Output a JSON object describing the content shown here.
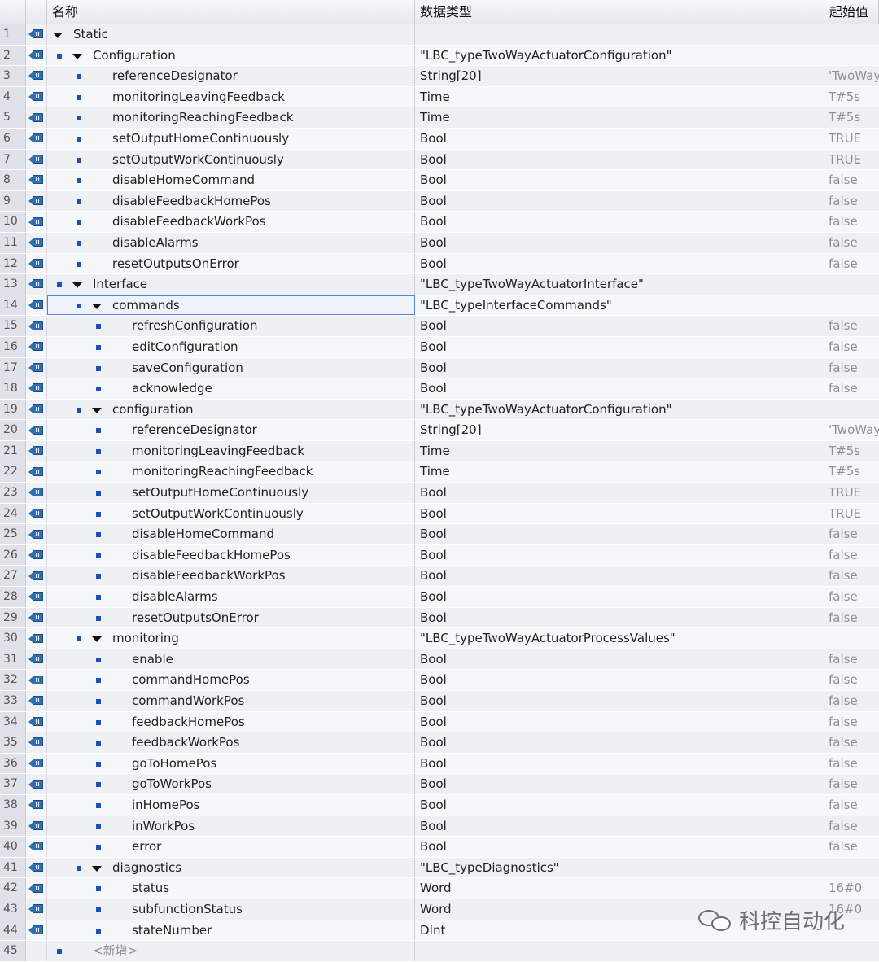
{
  "columns": {
    "name": "名称",
    "type": "数据类型",
    "start": "起始值"
  },
  "rows": [
    {
      "n": "1",
      "level": 0,
      "marker": false,
      "expand": true,
      "name": "Static",
      "type": "",
      "start": ""
    },
    {
      "n": "2",
      "level": 1,
      "marker": true,
      "expand": true,
      "name": "Configuration",
      "type": "\"LBC_typeTwoWayActuatorConfiguration\"",
      "start": ""
    },
    {
      "n": "3",
      "level": 2,
      "marker": true,
      "expand": false,
      "name": "referenceDesignator",
      "type": "String[20]",
      "start": "'TwoWay"
    },
    {
      "n": "4",
      "level": 2,
      "marker": true,
      "expand": false,
      "name": "monitoringLeavingFeedback",
      "type": "Time",
      "start": "T#5s"
    },
    {
      "n": "5",
      "level": 2,
      "marker": true,
      "expand": false,
      "name": "monitoringReachingFeedback",
      "type": "Time",
      "start": "T#5s"
    },
    {
      "n": "6",
      "level": 2,
      "marker": true,
      "expand": false,
      "name": "setOutputHomeContinuously",
      "type": "Bool",
      "start": "TRUE"
    },
    {
      "n": "7",
      "level": 2,
      "marker": true,
      "expand": false,
      "name": "setOutputWorkContinuously",
      "type": "Bool",
      "start": "TRUE"
    },
    {
      "n": "8",
      "level": 2,
      "marker": true,
      "expand": false,
      "name": "disableHomeCommand",
      "type": "Bool",
      "start": "false"
    },
    {
      "n": "9",
      "level": 2,
      "marker": true,
      "expand": false,
      "name": "disableFeedbackHomePos",
      "type": "Bool",
      "start": "false"
    },
    {
      "n": "10",
      "level": 2,
      "marker": true,
      "expand": false,
      "name": "disableFeedbackWorkPos",
      "type": "Bool",
      "start": "false"
    },
    {
      "n": "11",
      "level": 2,
      "marker": true,
      "expand": false,
      "name": "disableAlarms",
      "type": "Bool",
      "start": "false"
    },
    {
      "n": "12",
      "level": 2,
      "marker": true,
      "expand": false,
      "name": "resetOutputsOnError",
      "type": "Bool",
      "start": "false"
    },
    {
      "n": "13",
      "level": 1,
      "marker": true,
      "expand": true,
      "name": "Interface",
      "type": "\"LBC_typeTwoWayActuatorInterface\"",
      "start": ""
    },
    {
      "n": "14",
      "level": 2,
      "marker": true,
      "expand": true,
      "name": "commands",
      "type": "\"LBC_typeInterfaceCommands\"",
      "start": "",
      "selected": true
    },
    {
      "n": "15",
      "level": 3,
      "marker": true,
      "expand": false,
      "name": "refreshConfiguration",
      "type": "Bool",
      "start": "false"
    },
    {
      "n": "16",
      "level": 3,
      "marker": true,
      "expand": false,
      "name": "editConfiguration",
      "type": "Bool",
      "start": "false"
    },
    {
      "n": "17",
      "level": 3,
      "marker": true,
      "expand": false,
      "name": "saveConfiguration",
      "type": "Bool",
      "start": "false"
    },
    {
      "n": "18",
      "level": 3,
      "marker": true,
      "expand": false,
      "name": "acknowledge",
      "type": "Bool",
      "start": "false"
    },
    {
      "n": "19",
      "level": 2,
      "marker": true,
      "expand": true,
      "name": "configuration",
      "type": "\"LBC_typeTwoWayActuatorConfiguration\"",
      "start": ""
    },
    {
      "n": "20",
      "level": 3,
      "marker": true,
      "expand": false,
      "name": "referenceDesignator",
      "type": "String[20]",
      "start": "'TwoWay"
    },
    {
      "n": "21",
      "level": 3,
      "marker": true,
      "expand": false,
      "name": "monitoringLeavingFeedback",
      "type": "Time",
      "start": "T#5s"
    },
    {
      "n": "22",
      "level": 3,
      "marker": true,
      "expand": false,
      "name": "monitoringReachingFeedback",
      "type": "Time",
      "start": "T#5s"
    },
    {
      "n": "23",
      "level": 3,
      "marker": true,
      "expand": false,
      "name": "setOutputHomeContinuously",
      "type": "Bool",
      "start": "TRUE"
    },
    {
      "n": "24",
      "level": 3,
      "marker": true,
      "expand": false,
      "name": "setOutputWorkContinuously",
      "type": "Bool",
      "start": "TRUE"
    },
    {
      "n": "25",
      "level": 3,
      "marker": true,
      "expand": false,
      "name": "disableHomeCommand",
      "type": "Bool",
      "start": "false"
    },
    {
      "n": "26",
      "level": 3,
      "marker": true,
      "expand": false,
      "name": "disableFeedbackHomePos",
      "type": "Bool",
      "start": "false"
    },
    {
      "n": "27",
      "level": 3,
      "marker": true,
      "expand": false,
      "name": "disableFeedbackWorkPos",
      "type": "Bool",
      "start": "false"
    },
    {
      "n": "28",
      "level": 3,
      "marker": true,
      "expand": false,
      "name": "disableAlarms",
      "type": "Bool",
      "start": "false"
    },
    {
      "n": "29",
      "level": 3,
      "marker": true,
      "expand": false,
      "name": "resetOutputsOnError",
      "type": "Bool",
      "start": "false"
    },
    {
      "n": "30",
      "level": 2,
      "marker": true,
      "expand": true,
      "name": "monitoring",
      "type": "\"LBC_typeTwoWayActuatorProcessValues\"",
      "start": ""
    },
    {
      "n": "31",
      "level": 3,
      "marker": true,
      "expand": false,
      "name": "enable",
      "type": "Bool",
      "start": "false"
    },
    {
      "n": "32",
      "level": 3,
      "marker": true,
      "expand": false,
      "name": "commandHomePos",
      "type": "Bool",
      "start": "false"
    },
    {
      "n": "33",
      "level": 3,
      "marker": true,
      "expand": false,
      "name": "commandWorkPos",
      "type": "Bool",
      "start": "false"
    },
    {
      "n": "34",
      "level": 3,
      "marker": true,
      "expand": false,
      "name": "feedbackHomePos",
      "type": "Bool",
      "start": "false"
    },
    {
      "n": "35",
      "level": 3,
      "marker": true,
      "expand": false,
      "name": "feedbackWorkPos",
      "type": "Bool",
      "start": "false"
    },
    {
      "n": "36",
      "level": 3,
      "marker": true,
      "expand": false,
      "name": "goToHomePos",
      "type": "Bool",
      "start": "false"
    },
    {
      "n": "37",
      "level": 3,
      "marker": true,
      "expand": false,
      "name": "goToWorkPos",
      "type": "Bool",
      "start": "false"
    },
    {
      "n": "38",
      "level": 3,
      "marker": true,
      "expand": false,
      "name": "inHomePos",
      "type": "Bool",
      "start": "false"
    },
    {
      "n": "39",
      "level": 3,
      "marker": true,
      "expand": false,
      "name": "inWorkPos",
      "type": "Bool",
      "start": "false"
    },
    {
      "n": "40",
      "level": 3,
      "marker": true,
      "expand": false,
      "name": "error",
      "type": "Bool",
      "start": "false"
    },
    {
      "n": "41",
      "level": 2,
      "marker": true,
      "expand": true,
      "name": "diagnostics",
      "type": "\"LBC_typeDiagnostics\"",
      "start": ""
    },
    {
      "n": "42",
      "level": 3,
      "marker": true,
      "expand": false,
      "name": "status",
      "type": "Word",
      "start": "16#0"
    },
    {
      "n": "43",
      "level": 3,
      "marker": true,
      "expand": false,
      "name": "subfunctionStatus",
      "type": "Word",
      "start": "16#0"
    },
    {
      "n": "44",
      "level": 3,
      "marker": true,
      "expand": false,
      "name": "stateNumber",
      "type": "DInt",
      "start": ""
    },
    {
      "n": "45",
      "level": 1,
      "marker": true,
      "expand": false,
      "name": "<新增>",
      "type": "",
      "start": "",
      "newrow": true
    }
  ],
  "watermark": "科控自动化"
}
